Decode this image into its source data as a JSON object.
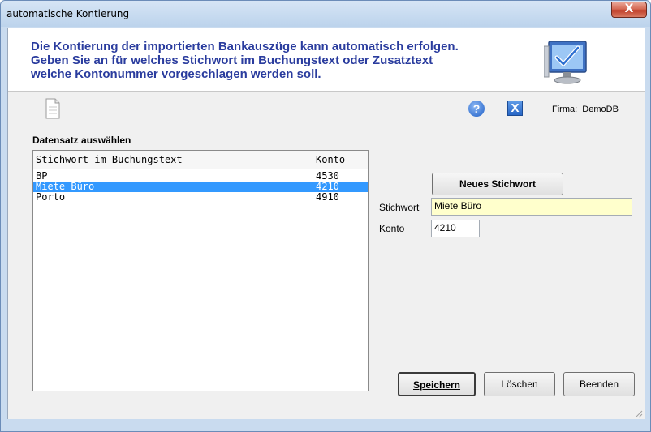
{
  "window": {
    "title": "automatische Kontierung",
    "close_glyph": "X"
  },
  "header": {
    "lines": [
      "Die Kontierung der importierten Bankauszüge kann automatisch erfolgen.",
      "Geben Sie  an für welches Stichwort im Buchungstext oder Zusatztext",
      "welche Kontonummer vorgeschlagen werden soll."
    ],
    "icon": "monitor-checkmark-icon"
  },
  "toolbar": {
    "new_doc_icon": "document-icon",
    "help_icon": "help-icon",
    "help_glyph": "?",
    "close_icon": "close-x-icon",
    "close_glyph": "X",
    "firma_label": "Firma:",
    "firma_value": "DemoDB"
  },
  "list": {
    "section_label": "Datensatz auswählen",
    "columns": [
      "Stichwort im Buchungstext",
      "Konto"
    ],
    "rows": [
      {
        "stichwort": "BP",
        "konto": "4530",
        "selected": false
      },
      {
        "stichwort": "Miete Büro",
        "konto": "4210",
        "selected": true
      },
      {
        "stichwort": "Porto",
        "konto": "4910",
        "selected": false
      }
    ]
  },
  "form": {
    "new_button": "Neues Stichwort",
    "stichwort_label": "Stichwort",
    "stichwort_value": "Miete Büro",
    "konto_label": "Konto",
    "konto_value": "4210"
  },
  "buttons": {
    "save": "Speichern",
    "delete": "Löschen",
    "close": "Beenden"
  },
  "colors": {
    "header_text": "#2a3c9e",
    "selection": "#3399ff",
    "stichwort_bg": "#ffffcc"
  }
}
